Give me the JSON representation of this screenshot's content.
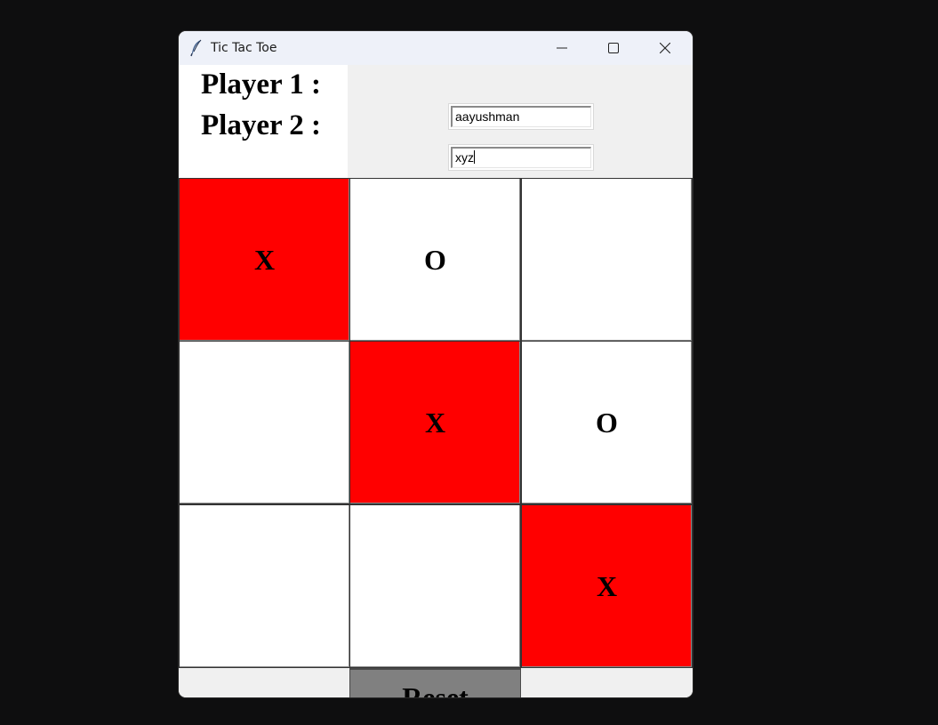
{
  "window": {
    "title": "Tic Tac Toe",
    "app_icon": "feather-icon",
    "controls": [
      "minimize-icon",
      "maximize-icon",
      "close-icon"
    ]
  },
  "players": {
    "p1_label": "Player 1 :",
    "p1_value": "aayushman",
    "p2_label": "Player 2 :",
    "p2_value": "xyz"
  },
  "board": {
    "cells": [
      {
        "mark": "X",
        "highlight": true
      },
      {
        "mark": "O",
        "highlight": false
      },
      {
        "mark": "",
        "highlight": false
      },
      {
        "mark": "",
        "highlight": false
      },
      {
        "mark": "X",
        "highlight": true
      },
      {
        "mark": "O",
        "highlight": false
      },
      {
        "mark": "",
        "highlight": false
      },
      {
        "mark": "",
        "highlight": false
      },
      {
        "mark": "X",
        "highlight": true
      }
    ],
    "highlight_color": "#ff0000",
    "cell_color": "#ffffff"
  },
  "controls": {
    "reset_label": "Reset",
    "reset_color": "#808080"
  }
}
